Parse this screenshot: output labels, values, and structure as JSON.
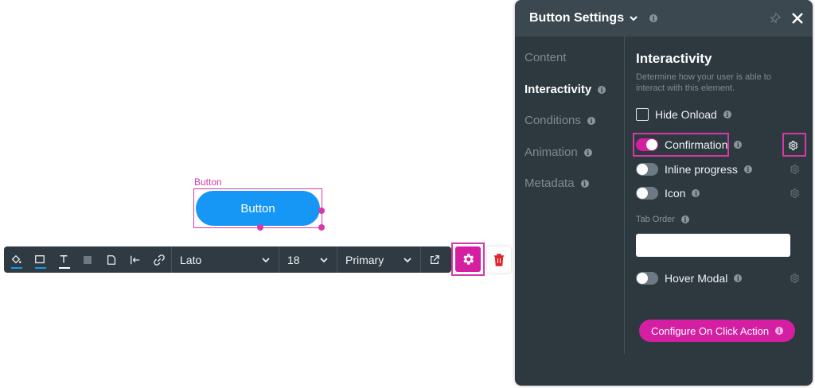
{
  "canvas": {
    "element_label": "Button",
    "button_label": "Button"
  },
  "toolbar": {
    "font": "Lato",
    "size": "18",
    "style": "Primary"
  },
  "panel": {
    "title": "Button Settings",
    "nav": [
      "Content",
      "Interactivity",
      "Conditions",
      "Animation",
      "Metadata"
    ],
    "active_index": 1,
    "section_title": "Interactivity",
    "section_desc": "Determine how your user is able to interact with this element.",
    "hide_onload": "Hide Onload",
    "options": [
      {
        "label": "Confirmation",
        "on": true
      },
      {
        "label": "Inline progress",
        "on": false
      },
      {
        "label": "Icon",
        "on": false
      }
    ],
    "tab_order_label": "Tab Order",
    "tab_order_value": "",
    "hover_modal": "Hover Modal",
    "configure_btn": "Configure On Click Action",
    "info_glyph": "i"
  },
  "colors": {
    "accent": "#d41fa3",
    "button_blue": "#1797f5",
    "panel_bg": "#2d383f"
  }
}
